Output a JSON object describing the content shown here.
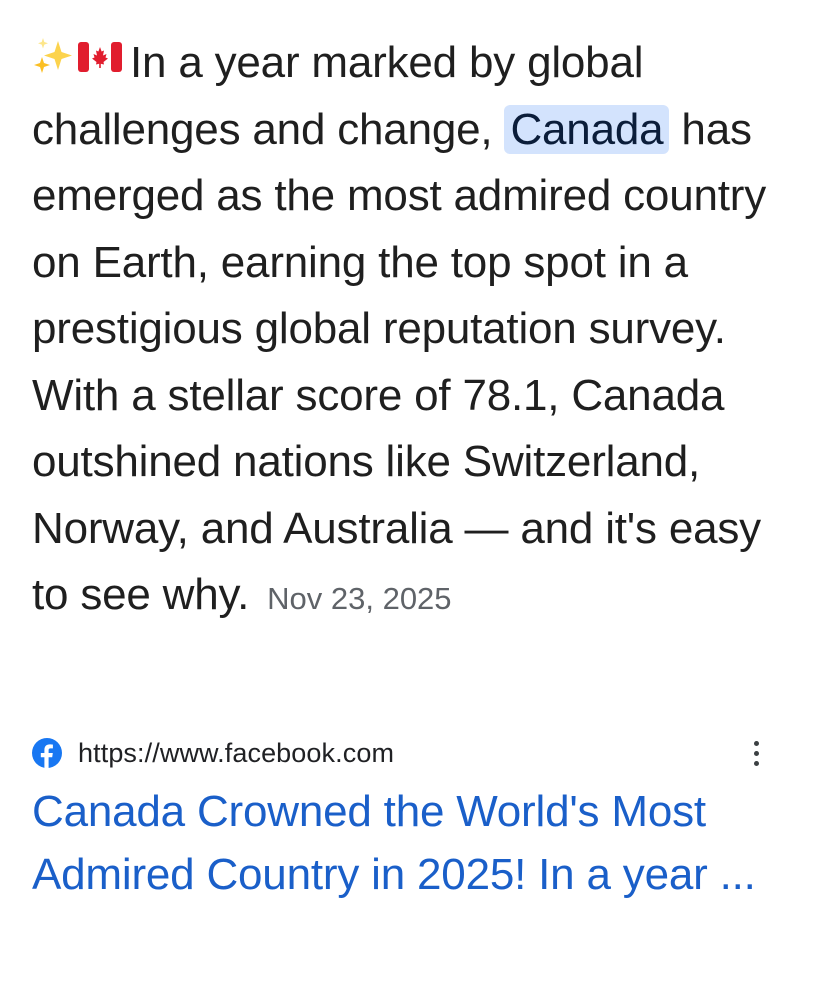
{
  "snippet": {
    "icons": [
      "sparkles-icon",
      "canada-flag-icon"
    ],
    "text_before_highlight": "In a year marked by global challenges and change,",
    "highlight": "Canada",
    "text_after_highlight": "has emerged as the most admired country on Earth, earning the top spot in a prestigious global reputation survey. With a stellar score of 78.1, Canada outshined nations like Switzerland, Norway, and Australia — and it's easy to see why.",
    "date": "Nov 23, 2025",
    "highlight_color": "#d3e3fd"
  },
  "result": {
    "source_icon": "facebook-icon",
    "source_url": "https://www.facebook.com",
    "more_icon": "more-vert-icon",
    "title": "Canada Crowned the World's Most Admired Country in 2025! In a year ...",
    "title_color": "#1a5fc9",
    "facebook_color": "#1877f2"
  }
}
